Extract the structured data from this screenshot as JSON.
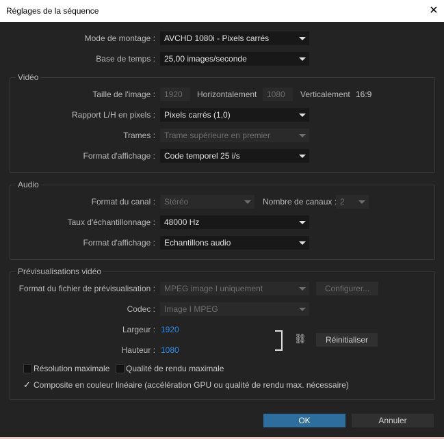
{
  "dialog": {
    "title": "Réglages de la séquence",
    "close_glyph": "✕"
  },
  "edit_mode": {
    "label": "Mode de montage :",
    "value": "AVCHD 1080i - Pixels carrés"
  },
  "timebase": {
    "label": "Base de temps :",
    "value": "25,00 images/seconde"
  },
  "video": {
    "title": "Vidéo",
    "frame_size_label": "Taille de l'image :",
    "width_value": "1920",
    "horizontal_label": "Horizontalement",
    "height_value": "1080",
    "vertical_label": "Verticalement",
    "aspect": "16:9",
    "pixel_aspect_label": "Rapport L/H en pixels :",
    "pixel_aspect_value": "Pixels carrés (1,0)",
    "fields_label": "Trames :",
    "fields_value": "Trame supérieure en premier",
    "display_format_label": "Format d'affichage :",
    "display_format_value": "Code temporel 25 i/s"
  },
  "audio": {
    "title": "Audio",
    "channel_format_label": "Format du canal :",
    "channel_format_value": "Stéréo",
    "num_channels_label": "Nombre de canaux :",
    "num_channels_value": "2",
    "sample_rate_label": "Taux d'échantillonnage :",
    "sample_rate_value": "48000 Hz",
    "display_format_label": "Format d'affichage :",
    "display_format_value": "Echantillons audio"
  },
  "preview": {
    "title": "Prévisualisations vidéo",
    "file_format_label": "Format du fichier de prévisualisation :",
    "file_format_value": "MPEG image I uniquement",
    "configure_label": "Configurer...",
    "codec_label": "Codec :",
    "codec_value": "Image I MPEG",
    "width_label": "Largeur :",
    "width_value": "1920",
    "height_label": "Hauteur :",
    "height_value": "1080",
    "link_icon": "⛓",
    "reset_label": "Réinitialiser",
    "max_res_label": "Résolution maximale",
    "max_quality_label": "Qualité de rendu maximale",
    "linear_label": "Composite en couleur linéaire (accélération GPU ou qualité de rendu max. nécessaire)",
    "check_glyph": "✓"
  },
  "footer": {
    "ok_label": "OK",
    "cancel_label": "Annuler"
  }
}
